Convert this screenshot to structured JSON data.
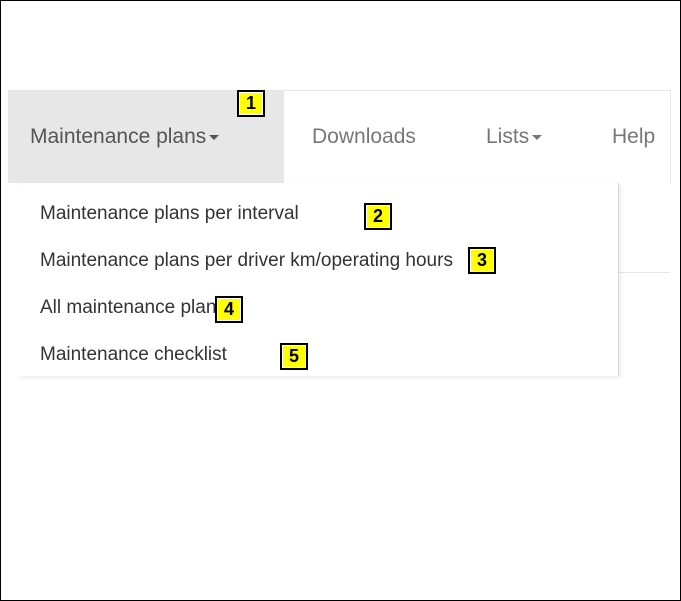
{
  "navbar": {
    "maintenance_plans": "Maintenance plans",
    "downloads": "Downloads",
    "lists": "Lists",
    "help": "Help"
  },
  "dropdown": {
    "items": [
      "Maintenance plans per interval",
      "Maintenance plans per driver km/operating hours",
      "All maintenance plans",
      "Maintenance checklist"
    ]
  },
  "markers": [
    "1",
    "2",
    "3",
    "4",
    "5"
  ],
  "colors": {
    "marker_bg": "#ffff00",
    "active_nav_bg": "#e7e7e7"
  },
  "icons": {
    "caret": "caret-down-icon"
  }
}
